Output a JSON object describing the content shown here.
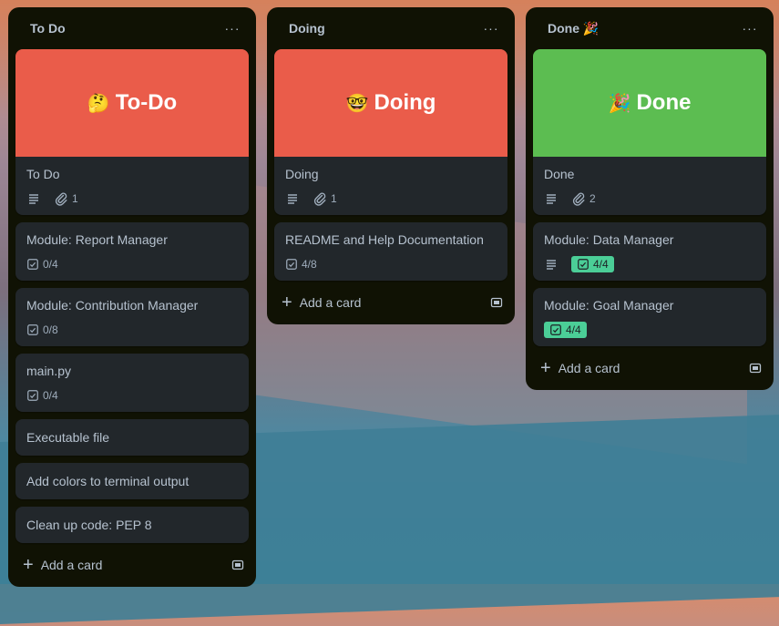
{
  "lists": [
    {
      "title": "To Do",
      "cover": {
        "emoji": "🤔",
        "text": "To-Do",
        "color": "#ea5c4a"
      },
      "cards": [
        {
          "title": "To Do",
          "attachments": "1"
        },
        {
          "title": "Module: Report Manager",
          "checklist": "0/4"
        },
        {
          "title": "Module: Contribution Manager",
          "checklist": "0/8"
        },
        {
          "title": "main.py",
          "checklist": "0/4"
        },
        {
          "title": "Executable file"
        },
        {
          "title": "Add colors to terminal output"
        },
        {
          "title": "Clean up code: PEP 8"
        }
      ],
      "add_card": "Add a card"
    },
    {
      "title": "Doing",
      "cover": {
        "emoji": "🤓",
        "text": "Doing",
        "color": "#ea5c4a"
      },
      "cards": [
        {
          "title": "Doing",
          "attachments": "1"
        },
        {
          "title": "README and Help Documentation",
          "checklist": "4/8"
        }
      ],
      "add_card": "Add a card"
    },
    {
      "title": "Done 🎉",
      "cover": {
        "emoji": "🎉",
        "text": "Done",
        "color": "#5cbd51"
      },
      "cards": [
        {
          "title": "Done",
          "attachments": "2"
        },
        {
          "title": "Module: Data Manager",
          "checklist": "4/4"
        },
        {
          "title": "Module: Goal Manager",
          "checklist": "4/4"
        }
      ],
      "add_card": "Add a card"
    }
  ],
  "menu_glyph": "···",
  "colors": {
    "list_bg": "#101204",
    "card_bg": "#22272b",
    "text": "#b6c2cf",
    "complete_badge": "#4bce97"
  },
  "icons": {
    "description": "description-icon",
    "attachment": "paperclip-icon",
    "checklist": "checklist-icon",
    "menu": "more-icon",
    "add": "plus-icon",
    "template": "card-template-icon"
  }
}
